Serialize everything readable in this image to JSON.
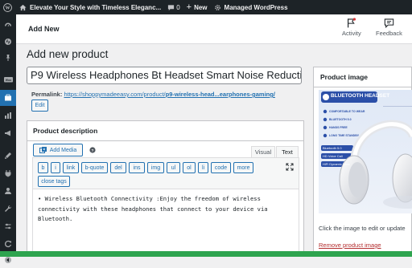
{
  "adminbar": {
    "site_name": "Elevate Your Style with Timeless Eleganc...",
    "comments_count": "0",
    "new_label": "New",
    "managed_label": "Managed WordPress"
  },
  "header": {
    "title": "Add New",
    "activity_label": "Activity",
    "feedback_label": "Feedback"
  },
  "page": {
    "title": "Add new product",
    "product_title": "P9 Wireless Headphones Bt Headset Smart Noise Reduction",
    "permalink_label": "Permalink:",
    "permalink_base": "https://shoppymadeeasy.com/product/",
    "permalink_slug": "p9-wireless-head...earphones-gaming/",
    "edit_label": "Edit"
  },
  "description": {
    "heading": "Product description",
    "add_media_label": "Add Media",
    "tab_visual": "Visual",
    "tab_text": "Text",
    "quicktags": [
      "b",
      "i",
      "link",
      "b-quote",
      "del",
      "ins",
      "img",
      "ul",
      "ol",
      "li",
      "code",
      "more"
    ],
    "close_tags_label": "close tags",
    "content": "• Wireless Bluetooth Connectivity :Enjoy the freedom of wireless connectivity with these headphones that connect to your device via Bluetooth."
  },
  "product_image": {
    "heading": "Product image",
    "image_title": "BLUETOOTH HEADSET",
    "features": [
      "COMFORTABLE TO WEAR",
      "BLUETOOTH 5.0",
      "HANDS FREE",
      "LONG TIME STANDBY"
    ],
    "tags": [
      "Bluetooth 5.0",
      "HD Voice Call",
      "HiFi Dynamic Bass"
    ],
    "hint": "Click the image to edit or update",
    "remove_label": "Remove product image"
  },
  "colors": {
    "admin_dark": "#1d2327",
    "accent": "#2271b1",
    "remove_red": "#b32d2e",
    "bottom_strip": "#2ea44f"
  }
}
